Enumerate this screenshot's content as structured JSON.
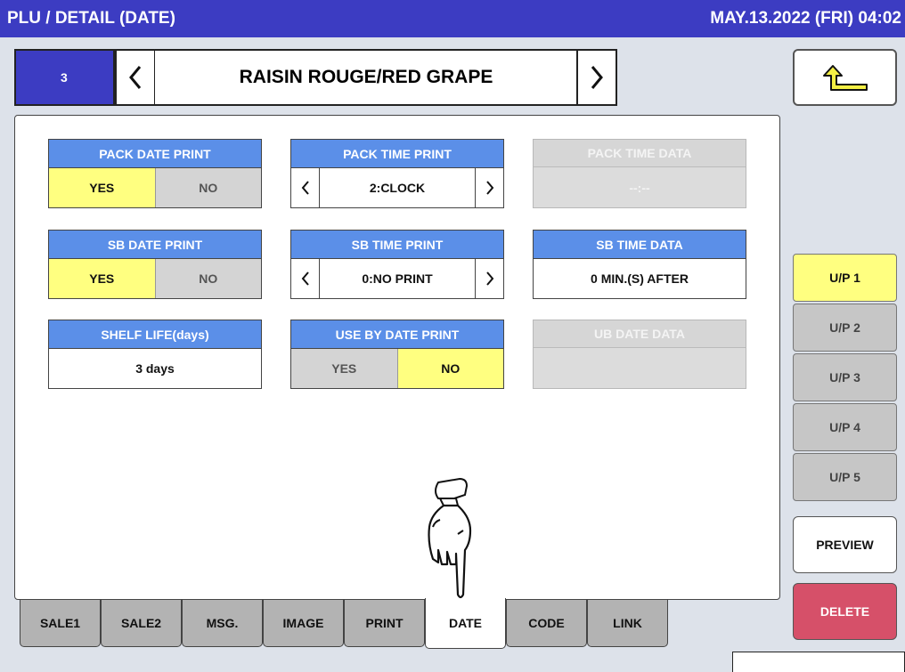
{
  "header": {
    "title": "PLU / DETAIL (DATE)",
    "datetime": "MAY.13.2022 (FRI)  04:02"
  },
  "plu": {
    "number": "3",
    "name": "RAISIN ROUGE/RED GRAPE"
  },
  "icons": {
    "prev": "chevron-left-icon",
    "next": "chevron-right-icon",
    "back": "return-arrow-icon",
    "pointer": "pointing-hand-icon"
  },
  "fields": {
    "pack_date_print": {
      "label": "PACK DATE PRINT",
      "yes": "YES",
      "no": "NO",
      "selected": "YES"
    },
    "pack_time_print": {
      "label": "PACK TIME PRINT",
      "value": "2:CLOCK"
    },
    "pack_time_data": {
      "label": "PACK TIME DATA",
      "value": "--:--",
      "enabled": false
    },
    "sb_date_print": {
      "label": "SB DATE PRINT",
      "yes": "YES",
      "no": "NO",
      "selected": "YES"
    },
    "sb_time_print": {
      "label": "SB TIME PRINT",
      "value": "0:NO PRINT"
    },
    "sb_time_data": {
      "label": "SB TIME DATA",
      "value": "0 MIN.(S) AFTER"
    },
    "shelf_life": {
      "label": "SHELF LIFE(days)",
      "value": "3 days"
    },
    "use_by_date_print": {
      "label": "USE BY DATE PRINT",
      "yes": "YES",
      "no": "NO",
      "selected": "NO"
    },
    "ub_date_data": {
      "label": "UB DATE DATA",
      "value": "",
      "enabled": false
    }
  },
  "tabs": [
    {
      "label": "SALE1"
    },
    {
      "label": "SALE2"
    },
    {
      "label": "MSG."
    },
    {
      "label": "IMAGE"
    },
    {
      "label": "PRINT"
    },
    {
      "label": "DATE",
      "active": true
    },
    {
      "label": "CODE"
    },
    {
      "label": "LINK"
    }
  ],
  "unit_prices": [
    {
      "label": "U/P 1",
      "active": true
    },
    {
      "label": "U/P 2"
    },
    {
      "label": "U/P 3"
    },
    {
      "label": "U/P 4"
    },
    {
      "label": "U/P 5"
    }
  ],
  "buttons": {
    "preview": "PREVIEW",
    "delete": "DELETE"
  },
  "colors": {
    "title_bar": "#3c3cc2",
    "field_header": "#5b8fe8",
    "selected": "#ffff80",
    "delete": "#d65069"
  }
}
